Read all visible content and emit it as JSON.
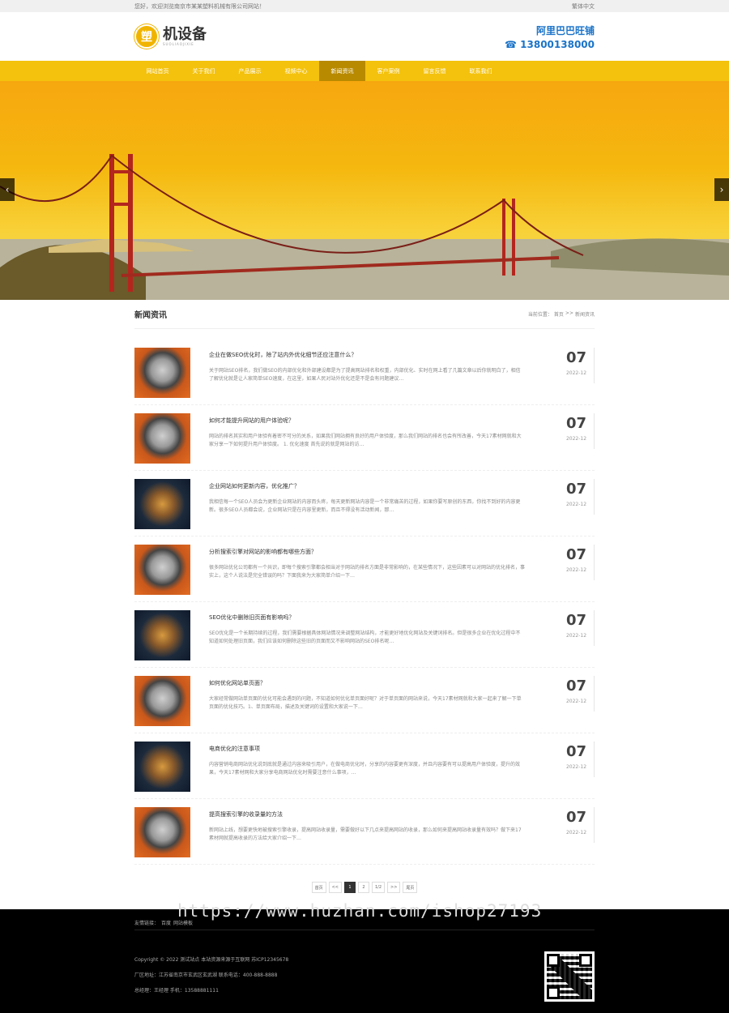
{
  "topbar": {
    "welcome": "您好，欢迎浏览南京市某某塑料机械有限公司网站！",
    "lang": "繁体中文"
  },
  "header": {
    "logo_badge": "塑",
    "logo_name": "机设备",
    "logo_sub": "SUOLIAOJIXIE",
    "shop": "阿里巴巴旺铺",
    "phone": "☎ 13800138000"
  },
  "nav": {
    "items": [
      {
        "label": "网站首页",
        "active": false
      },
      {
        "label": "关于我们",
        "active": false
      },
      {
        "label": "产品展示",
        "active": false
      },
      {
        "label": "视频中心",
        "active": false
      },
      {
        "label": "新闻资讯",
        "active": true
      },
      {
        "label": "客户案例",
        "active": false
      },
      {
        "label": "留言反馈",
        "active": false
      },
      {
        "label": "联系我们",
        "active": false
      }
    ]
  },
  "banner": {
    "prev": "‹",
    "next": "›"
  },
  "section": {
    "title": "新闻资讯",
    "breadcrumb": {
      "prefix": "当前位置：",
      "home": "首页",
      "sep": ">>",
      "current": "新闻资讯"
    }
  },
  "news": [
    {
      "title": "企业在做SEO优化时，除了站内外优化细节还应注意什么？",
      "desc": "关于网站SEO排名，我们做SEO的内部优化和外部建设都是为了提高网站排名和权重，内部优化、实时在网上看了几篇文章以后你就明白了，相信了解优化就是让人家简单SEO速度，在这里，如果人民对站外优化还是不是会有问题建议…",
      "day": "07",
      "ym": "2022-12",
      "thumb": "engine"
    },
    {
      "title": "如何才能提升网站的用户体验呢？",
      "desc": "网站的排名其实和用户体验有着密不可分的关系，如果我们网站拥有良好的用户体验度，那么我们网站的排名也会有所改善，今天17素材网就和大家分享一下如何提升用户体验度。 1. 优化速度 首先说的就是网站的访…",
      "day": "07",
      "ym": "2022-12",
      "thumb": "engine"
    },
    {
      "title": "企业网站如何更新内容，优化推广？",
      "desc": "我相信每一个SEO人员会为更新企业网站的内容而头疼，每天更新网站内容是一个非常痛苦的过程，如果你要写原创的东西，你找不到好的内容更新。很多SEO人员都会说，企业网站只是在内容里更新，而且不得没有活动新闻，那…",
      "day": "07",
      "ym": "2022-12",
      "thumb": "cabinet"
    },
    {
      "title": "分析搜索引擎对网站的影响都有哪些方面？",
      "desc": "很多网站优化公司都有一个共识，即每个搜索引擎都会相当对于网站的排名方面是非常影响的，在某些情况下，这些因素可以对网站的优化排名，事实上，这个人说法是完全错误的吗？下面我来为大家简单介绍一下…",
      "day": "07",
      "ym": "2022-12",
      "thumb": "engine"
    },
    {
      "title": "SEO优化中删除旧页面有影响吗？",
      "desc": "SEO优化是一个长期持续的过程，我们需要根据具体网站情况来调整网站结构，才能更好地优化网站及关键词排名。但是很多企业在优化过程中不知道如何处理旧页面，我们应该如何删除这些旧的页面而又不影响网站的SEO排名呢…",
      "day": "07",
      "ym": "2022-12",
      "thumb": "cabinet"
    },
    {
      "title": "如何优化网站单页面？",
      "desc": "大家经常做网站单页面的优化可能会遇到的问题，不知道如何优化单页面好呢？对于单页面的网站来说，今天17素材网就和大家一起来了解一下单页面的优化技巧。1、单页面布局，描述及关键词的设置和大家说一下…",
      "day": "07",
      "ym": "2022-12",
      "thumb": "engine"
    },
    {
      "title": "电商优化的注意事项",
      "desc": "内容营销电商网站优化说到底就是通过内容来吸引用户，在做电商优化时，分享的内容要更有深度，并且内容要有可以提高用户体验度，提升的效果，今天17素材网和大家分享电商网站优化时需要注意什么事项，…",
      "day": "07",
      "ym": "2022-12",
      "thumb": "cabinet"
    },
    {
      "title": "提高搜索引擎的收录量的方法",
      "desc": "新网站上线，想要更快地被搜索引擎收录，提高网站收录量，需要做好以下几点来提高网站的收录，那么如何来提高网站收录量有效吗？做下来17素材网就提高收录的方法给大家介绍一下…",
      "day": "07",
      "ym": "2022-12",
      "thumb": "engine"
    }
  ],
  "pager": {
    "first": "首页",
    "prev": "<<",
    "p1": "1",
    "p2": "2",
    "info": "1/2",
    "next": ">>",
    "last": "尾页"
  },
  "footer": {
    "links_label": "友情链接：",
    "link1": "百度",
    "link2": "网站模板",
    "copyright": "Copyright © 2022 测试站点 本站资源来源于互联网 苏ICP12345678",
    "address": "厂区地址：江苏省南京市玄武区玄武湖    联系电话：400-888-8888",
    "manager": "总经理：王经理    手机：13588881111"
  },
  "watermark": "https://www.huzhan.com/ishop27193",
  "colors": {
    "nav": "#f4c20d",
    "nav_active": "#b88a00",
    "accent_blue": "#1a73c8",
    "footer": "#000000"
  }
}
